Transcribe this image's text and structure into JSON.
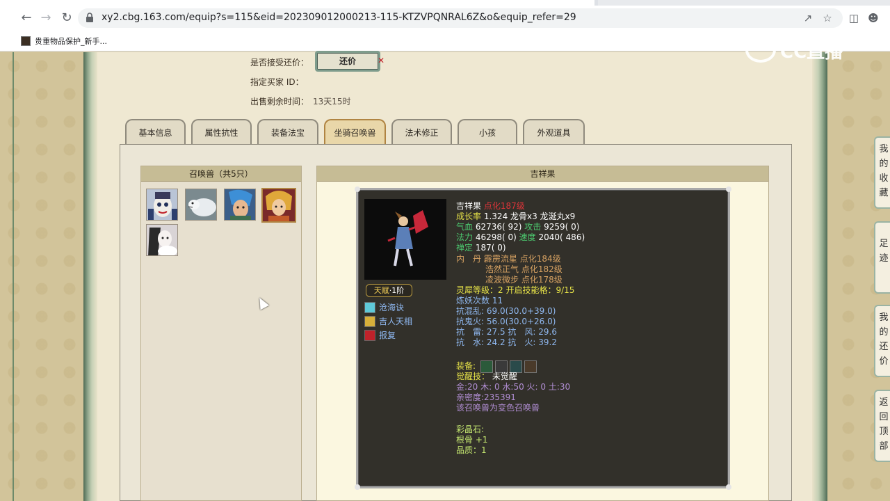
{
  "browser": {
    "url": "xy2.cbg.163.com/equip?s=115&eid=202309012000213-115-KTZVPQNRAL6Z&o&equip_refer=29",
    "bookmark_label": "贵重物品保护_新手..."
  },
  "watermark": "CC直播",
  "sale": {
    "accept_counter_label": "是否接受还价：",
    "counter_button": "还价",
    "counter_close": "✕",
    "buyer_id_label": "指定买家 ID：",
    "remaining_label": "出售剩余时间：",
    "remaining_value": "13天15时"
  },
  "tabs": [
    "基本信息",
    "属性抗性",
    "装备法宝",
    "坐骑召唤兽",
    "法术修正",
    "小孩",
    "外观道具"
  ],
  "pets": {
    "header": "召唤兽（共5只）",
    "count": 5,
    "selected_index": 3
  },
  "detail": {
    "header": "吉祥果",
    "talent_label": "天赋",
    "talent_level": "·1阶",
    "skills": [
      "沧海诀",
      "吉人天相",
      "报复"
    ],
    "name": "吉祥果",
    "name_level": "点化187级",
    "growth_label": "成长率",
    "growth_value": "1.324 龙骨x3 龙涎丸x9",
    "hp_label": "气血",
    "hp_value": "62736( 92)",
    "atk_label": "攻击",
    "atk_value": "9259( 0)",
    "mp_label": "法力",
    "mp_value": "46298( 0)",
    "spd_label": "速度",
    "spd_value": "2040( 486)",
    "zen_label": "禅定",
    "zen_value": "187( 0)",
    "neidan_label": "内　丹",
    "neidan": [
      {
        "name": "霹雳流星",
        "level": "点化184级"
      },
      {
        "name": "浩然正气",
        "level": "点化182级"
      },
      {
        "name": "凌波微步",
        "level": "点化178级"
      }
    ],
    "lingxi": "灵犀等级：2 开启技能格：9/15",
    "lianyao_label": "炼妖次数",
    "lianyao_value": "11",
    "res_chaos_label": "抗混乱:",
    "res_chaos_value": "69.0(30.0+39.0)",
    "res_ghost_label": "抗鬼火:",
    "res_ghost_value": "56.0(30.0+26.0)",
    "res_line1": "抗　雷: 27.5 抗　风: 29.6",
    "res_line2": "抗　水: 24.2 抗　火: 39.2",
    "equip_label": "装备:",
    "awaken_label": "觉醒技：",
    "awaken_value": "未觉醒",
    "elements": "金:20 木: 0 水:50 火: 0 土:30",
    "intimacy": "亲密度:235391",
    "variant_note": "该召唤兽为变色召唤兽",
    "crystal_label": "彩晶石:",
    "gengu": "根骨 +1",
    "quality": "品质：1"
  },
  "side_tabs": [
    "我的收藏",
    "足迹",
    "我的还价",
    "返回顶部"
  ]
}
